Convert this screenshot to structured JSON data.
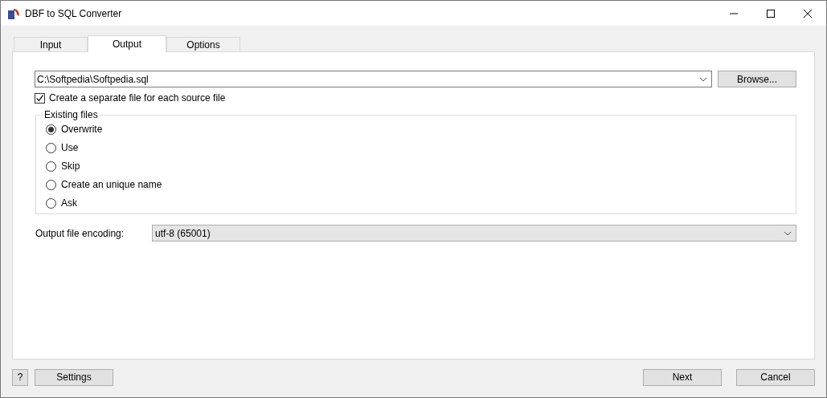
{
  "window": {
    "title": "DBF to SQL Converter"
  },
  "tabs": [
    {
      "label": "Input",
      "selected": false
    },
    {
      "label": "Output",
      "selected": true
    },
    {
      "label": "Options",
      "selected": false
    }
  ],
  "output_file": {
    "value": "C:\\Softpedia\\Softpedia.sql",
    "browse_button": "Browse..."
  },
  "separate_file": {
    "label": "Create a separate file for each source file",
    "checked": true
  },
  "existing_files": {
    "title": "Existing files",
    "options": [
      {
        "label": "Overwrite",
        "selected": true
      },
      {
        "label": "Use",
        "selected": false
      },
      {
        "label": "Skip",
        "selected": false
      },
      {
        "label": "Create an unique name",
        "selected": false
      },
      {
        "label": "Ask",
        "selected": false
      }
    ]
  },
  "encoding": {
    "label": "Output file encoding:",
    "value": "utf-8 (65001)"
  },
  "footer": {
    "help_button": "?",
    "settings_button": "Settings",
    "next_button": "Next",
    "cancel_button": "Cancel"
  }
}
